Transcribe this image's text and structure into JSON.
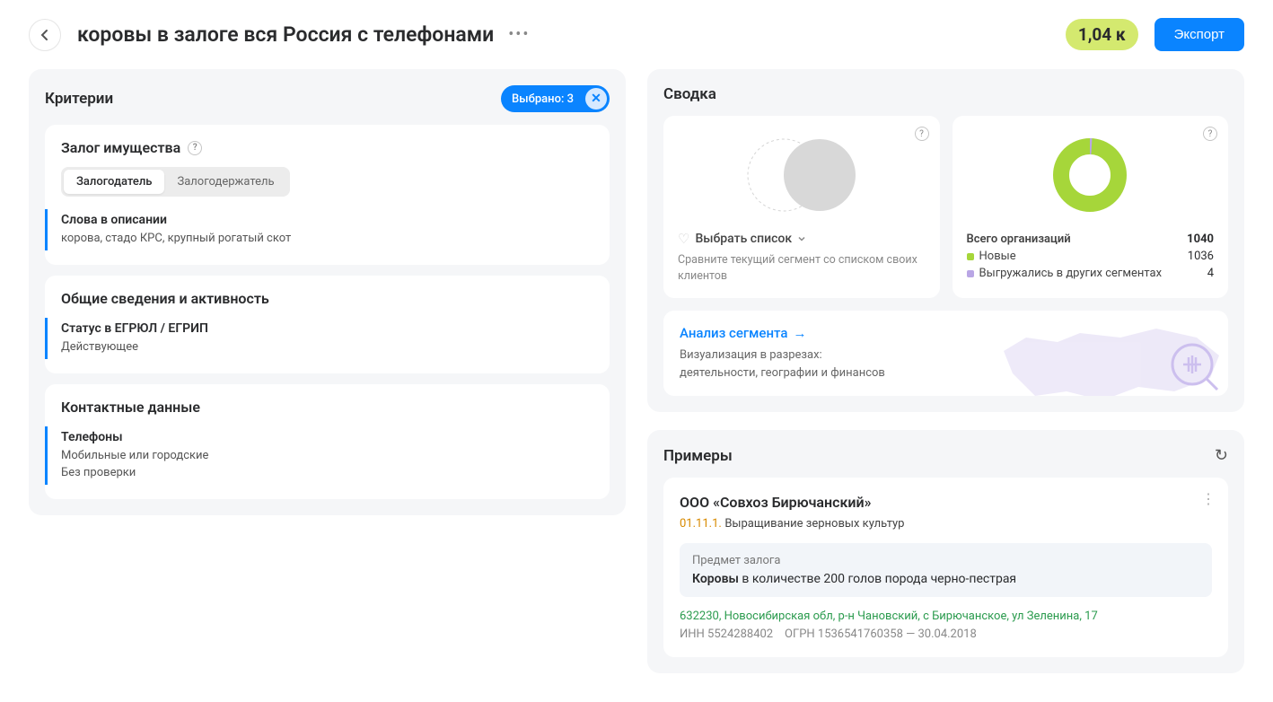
{
  "header": {
    "title": "коровы в залоге вся Россия с телефонами",
    "count": "1,04 к",
    "export": "Экспорт"
  },
  "criteria": {
    "title": "Критерии",
    "selected": "Выбрано: 3",
    "pledge": {
      "title": "Залог имущества",
      "tab_a": "Залогодатель",
      "tab_b": "Залогодержатель",
      "words_label": "Слова в описании",
      "words_value": "корова, стадо КРС, крупный рогатый скот"
    },
    "general": {
      "title": "Общие сведения и активность",
      "status_label": "Статус в ЕГРЮЛ / ЕГРИП",
      "status_value": "Действующее"
    },
    "contacts": {
      "title": "Контактные данные",
      "phones_label": "Телефоны",
      "phones_value": "Мобильные или городские\nБез проверки"
    }
  },
  "summary": {
    "title": "Сводка",
    "choose_list": "Выбрать список",
    "compare": "Сравните текущий сегмент со списком своих клиентов",
    "total_label": "Всего организаций",
    "total_val": "1040",
    "new_label": "Новые",
    "new_val": "1036",
    "seg_label": "Выгружались в других сегментах",
    "seg_val": "4",
    "analysis_link": "Анализ сегмента",
    "analysis_desc": "Визуализация в разрезах:\nдеятельности, географии и финансов"
  },
  "examples": {
    "title": "Примеры",
    "company": "ООО «Совхоз Бирючанский»",
    "code": "01.11.1.",
    "activity": "Выращивание зерновых культур",
    "pledge_label": "Предмет залога",
    "pledge_bold": "Коровы",
    "pledge_rest": " в количестве 200 голов порода черно-пестрая",
    "address": "632230, Новосибирская обл, р-н Чановский, с Бирючанское, ул Зеленина, 17",
    "inn": "ИНН 5524288402",
    "ogrn": "ОГРН 1536541760358 — 30.04.2018"
  },
  "chart_data": {
    "type": "pie",
    "title": "Всего организаций",
    "series": [
      {
        "name": "Новые",
        "value": 1036,
        "color": "#a6d63a"
      },
      {
        "name": "Выгружались в других сегментах",
        "value": 4,
        "color": "#b9a6e5"
      }
    ],
    "total": 1040
  }
}
